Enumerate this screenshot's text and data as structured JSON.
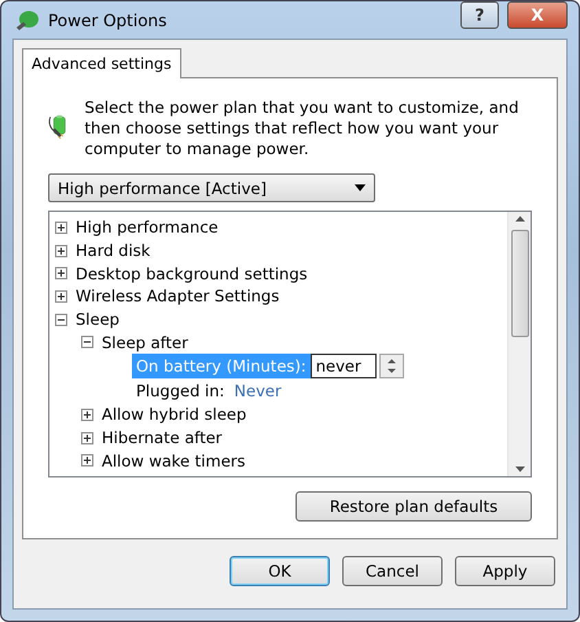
{
  "window": {
    "title": "Power Options",
    "help_button": "?",
    "close_button": "X"
  },
  "tabs": [
    {
      "label": "Advanced settings",
      "selected": true
    }
  ],
  "intro": "Select the power plan that you want to customize, and then choose settings that reflect how you want your computer to manage power.",
  "plan_dropdown": {
    "value": "High performance [Active]"
  },
  "tree": [
    {
      "label": "High performance",
      "expanded": false
    },
    {
      "label": "Hard disk",
      "expanded": false
    },
    {
      "label": "Desktop background settings",
      "expanded": false
    },
    {
      "label": "Wireless Adapter Settings",
      "expanded": false
    },
    {
      "label": "Sleep",
      "expanded": true,
      "children": [
        {
          "label": "Sleep after",
          "expanded": true,
          "settings": [
            {
              "kind": "edit",
              "label": "On battery (Minutes):",
              "value": "never",
              "selected": true
            },
            {
              "kind": "value",
              "label": "Plugged in:",
              "value": "Never",
              "selected": false
            }
          ]
        },
        {
          "label": "Allow hybrid sleep",
          "expanded": false
        },
        {
          "label": "Hibernate after",
          "expanded": false
        },
        {
          "label": "Allow wake timers",
          "expanded": false
        }
      ]
    }
  ],
  "restore_button": "Restore plan defaults",
  "buttons": [
    {
      "label": "OK",
      "default": true
    },
    {
      "label": "Cancel",
      "default": false
    },
    {
      "label": "Apply",
      "default": false
    }
  ]
}
